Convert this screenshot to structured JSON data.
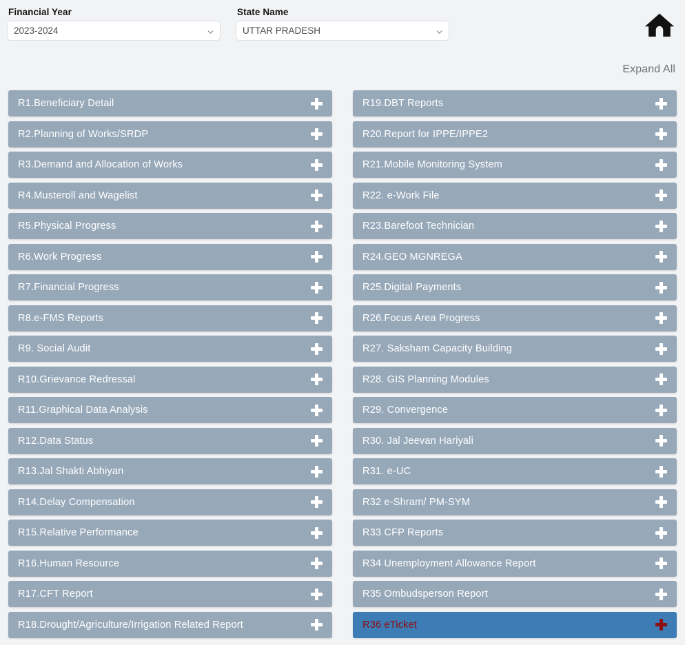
{
  "filters": {
    "financial_year": {
      "label": "Financial Year",
      "value": "2023-2024",
      "options": [
        "2023-2024"
      ]
    },
    "state_name": {
      "label": "State Name",
      "value": "UTTAR PRADESH",
      "options": [
        "UTTAR PRADESH"
      ]
    }
  },
  "header": {
    "home_icon": "home-icon",
    "expand_all_label": "Expand All"
  },
  "colors": {
    "page_background": "#f2f3f5",
    "row_background": "#97a8b9",
    "row_text": "#ffffff",
    "selected_row_background": "#3d7cb4",
    "selected_row_text": "#8b0f12",
    "expand_all_text": "#6f7378"
  },
  "reports": {
    "left_column": [
      {
        "label": "R1.Beneficiary Detail",
        "icon": "plus-icon",
        "selected": false
      },
      {
        "label": "R2.Planning of Works/SRDP",
        "icon": "plus-icon",
        "selected": false
      },
      {
        "label": "R3.Demand and Allocation of Works",
        "icon": "plus-icon",
        "selected": false
      },
      {
        "label": "R4.Musteroll and Wagelist",
        "icon": "plus-icon",
        "selected": false
      },
      {
        "label": "R5.Physical Progress",
        "icon": "plus-icon",
        "selected": false
      },
      {
        "label": "R6.Work Progress",
        "icon": "plus-icon",
        "selected": false
      },
      {
        "label": "R7.Financial Progress",
        "icon": "plus-icon",
        "selected": false
      },
      {
        "label": "R8.e-FMS Reports",
        "icon": "plus-icon",
        "selected": false
      },
      {
        "label": "R9. Social Audit",
        "icon": "plus-icon",
        "selected": false
      },
      {
        "label": "R10.Grievance Redressal",
        "icon": "plus-icon",
        "selected": false
      },
      {
        "label": "R11.Graphical Data Analysis",
        "icon": "plus-icon",
        "selected": false
      },
      {
        "label": "R12.Data Status",
        "icon": "plus-icon",
        "selected": false
      },
      {
        "label": "R13.Jal Shakti Abhiyan",
        "icon": "plus-icon",
        "selected": false
      },
      {
        "label": "R14.Delay Compensation",
        "icon": "plus-icon",
        "selected": false
      },
      {
        "label": "R15.Relative Performance",
        "icon": "plus-icon",
        "selected": false
      },
      {
        "label": "R16.Human Resource",
        "icon": "plus-icon",
        "selected": false
      },
      {
        "label": "R17.CFT Report",
        "icon": "plus-icon",
        "selected": false
      },
      {
        "label": "R18.Drought/Agriculture/Irrigation Related Report",
        "icon": "plus-icon",
        "selected": false
      }
    ],
    "right_column": [
      {
        "label": "R19.DBT Reports",
        "icon": "plus-icon",
        "selected": false
      },
      {
        "label": "R20.Report for IPPE/IPPE2",
        "icon": "plus-icon",
        "selected": false
      },
      {
        "label": "R21.Mobile Monitoring System",
        "icon": "plus-icon",
        "selected": false
      },
      {
        "label": "R22. e-Work File",
        "icon": "plus-icon",
        "selected": false
      },
      {
        "label": "R23.Barefoot Technician",
        "icon": "plus-icon",
        "selected": false
      },
      {
        "label": "R24.GEO MGNREGA",
        "icon": "plus-icon",
        "selected": false
      },
      {
        "label": "R25.Digital Payments",
        "icon": "plus-icon",
        "selected": false
      },
      {
        "label": "R26.Focus Area Progress",
        "icon": "plus-icon",
        "selected": false
      },
      {
        "label": "R27. Saksham Capacity Building",
        "icon": "plus-icon",
        "selected": false
      },
      {
        "label": "R28. GIS Planning Modules",
        "icon": "plus-icon",
        "selected": false
      },
      {
        "label": "R29. Convergence",
        "icon": "plus-icon",
        "selected": false
      },
      {
        "label": "R30. Jal Jeevan Hariyali",
        "icon": "plus-icon",
        "selected": false
      },
      {
        "label": "R31. e-UC",
        "icon": "plus-icon",
        "selected": false
      },
      {
        "label": "R32 e-Shram/ PM-SYM",
        "icon": "plus-icon",
        "selected": false
      },
      {
        "label": "R33 CFP Reports",
        "icon": "plus-icon",
        "selected": false
      },
      {
        "label": "R34 Unemployment Allowance Report",
        "icon": "plus-icon",
        "selected": false
      },
      {
        "label": "R35 Ombudsperson Report",
        "icon": "plus-icon",
        "selected": false
      },
      {
        "label": "R36 eTicket",
        "icon": "plus-icon",
        "selected": true
      }
    ]
  }
}
